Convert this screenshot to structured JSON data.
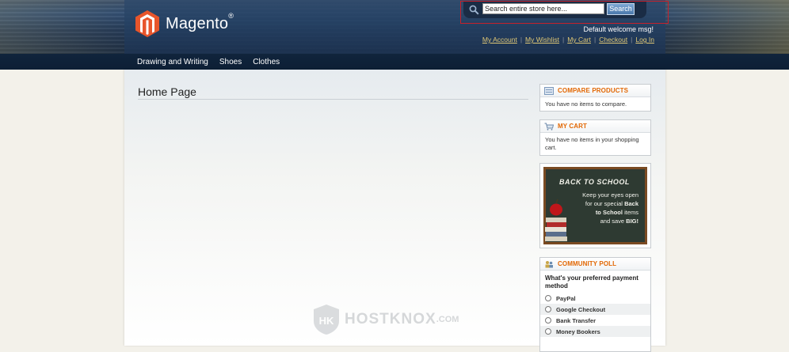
{
  "header": {
    "logo_text": "Magento",
    "logo_reg": "®",
    "search": {
      "placeholder": "Search entire store here...",
      "button_label": "Search"
    },
    "welcome": "Default welcome msg!",
    "links": [
      "My Account",
      "My Wishlist",
      "My Cart",
      "Checkout",
      "Log In"
    ]
  },
  "nav": {
    "items": [
      "Drawing and Writing",
      "Shoes",
      "Clothes"
    ]
  },
  "main": {
    "title": "Home Page"
  },
  "sidebar": {
    "compare": {
      "title": "COMPARE PRODUCTS",
      "body": "You have no items to compare."
    },
    "cart": {
      "title": "MY CART",
      "body": "You have no items in your shopping cart."
    },
    "promo": {
      "title": "BACK TO SCHOOL",
      "line1": "Keep your eyes open",
      "line2": "for our special",
      "line2_bold": "Back",
      "line3_bold": "to School",
      "line3": "items",
      "line4": "and save",
      "line4_bold": "BIG!"
    },
    "poll": {
      "title": "COMMUNITY POLL",
      "question": "What's your preferred payment method",
      "options": [
        "PayPal",
        "Google Checkout",
        "Bank Transfer",
        "Money Bookers"
      ]
    }
  },
  "watermark": {
    "text": "HOSTKNOX",
    "domain": ".COM"
  },
  "colors": {
    "accent": "#e26703",
    "header_dark": "#1e3556",
    "link_gold": "#e0c876"
  }
}
